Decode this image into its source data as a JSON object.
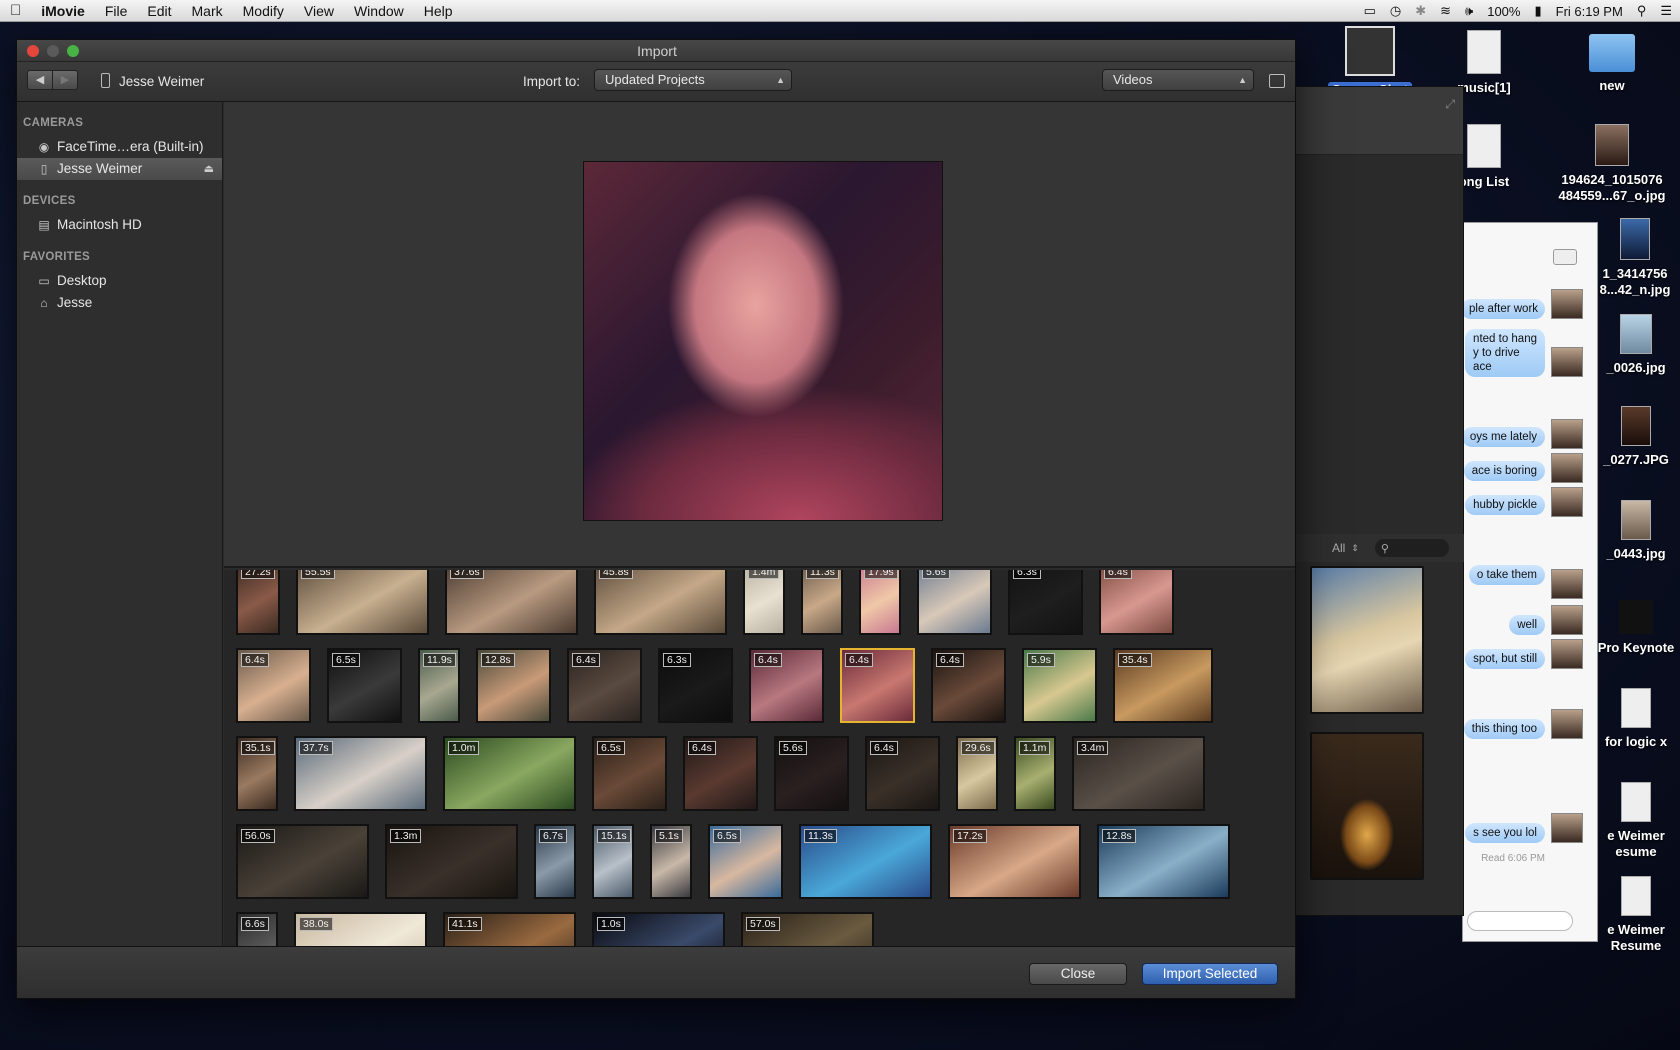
{
  "menubar": {
    "apple_icon": "apple-icon",
    "app_name": "iMovie",
    "menus": [
      "File",
      "Edit",
      "Mark",
      "Modify",
      "View",
      "Window",
      "Help"
    ],
    "battery": "100%",
    "clock": "Fri 6:19 PM",
    "status_icons": [
      "airplay-icon",
      "time-machine-icon",
      "bluetooth-icon",
      "wifi-icon",
      "volume-icon",
      "battery-icon",
      "spotlight-icon",
      "notification-list-icon"
    ]
  },
  "desktop": {
    "icons": [
      {
        "label": "Screen Shot"
      },
      {
        "label": "music[1]"
      },
      {
        "label": "new"
      },
      {
        "label": "ong List"
      },
      {
        "label": "194624_1015076\n484559...67_o.jpg"
      },
      {
        "label": "1_3414756\n8...42_n.jpg"
      },
      {
        "label": "_0026.jpg"
      },
      {
        "label": "_0277.JPG"
      },
      {
        "label": "_0443.jpg"
      },
      {
        "label": "Pro Keynote"
      },
      {
        "label": "for logic x"
      },
      {
        "label": "e Weimer\nesume"
      },
      {
        "label": "e Weimer\nResume"
      }
    ]
  },
  "messages": {
    "filter_label": "All",
    "bubbles": [
      "ple after work",
      "nted to hang\ny to drive\nace",
      "oys me lately",
      "ace is boring",
      "hubby pickle",
      "o take them",
      "well",
      "spot, but still",
      "this thing too",
      "s see you lol"
    ],
    "read_status": "Read 6:06 PM"
  },
  "window": {
    "title": "Import",
    "device_name": "Jesse Weimer",
    "import_to_label": "Import to:",
    "import_to_value": "Updated Projects",
    "type_value": "Videos"
  },
  "sidebar": {
    "sections": [
      {
        "title": "CAMERAS",
        "items": [
          "FaceTime…era (Built-in)",
          "Jesse Weimer"
        ]
      },
      {
        "title": "DEVICES",
        "items": [
          "Macintosh HD"
        ]
      },
      {
        "title": "FAVORITES",
        "items": [
          "Desktop",
          "Jesse"
        ]
      }
    ],
    "selected_item": "Jesse Weimer"
  },
  "clips": [
    [
      "27.2s",
      "55.5s",
      "37.6s",
      "45.8s",
      "1.4m",
      "11.3s",
      "17.9s",
      "5.6s",
      "6.3s",
      "6.4s"
    ],
    [
      "6.4s",
      "6.5s",
      "11.9s",
      "12.8s",
      "6.4s",
      "6.3s",
      "6.4s",
      "6.4s",
      "6.4s",
      "5.9s",
      "35.4s"
    ],
    [
      "35.1s",
      "37.7s",
      "1.0m",
      "6.5s",
      "6.4s",
      "5.6s",
      "6.4s",
      "29.6s",
      "1.1m",
      "3.4m"
    ],
    [
      "56.0s",
      "1.3m",
      "6.7s",
      "15.1s",
      "5.1s",
      "6.5s",
      "11.3s",
      "17.2s",
      "12.8s"
    ],
    [
      "6.6s",
      "38.0s",
      "41.1s",
      "1.0s",
      "57.0s"
    ]
  ],
  "selected_clip": "6.4s (row 2, clip 8)",
  "buttons": {
    "close": "Close",
    "import_selected": "Import Selected"
  },
  "colors": {
    "selection": "#e6b530",
    "primary_button": "#3a6fc0"
  }
}
